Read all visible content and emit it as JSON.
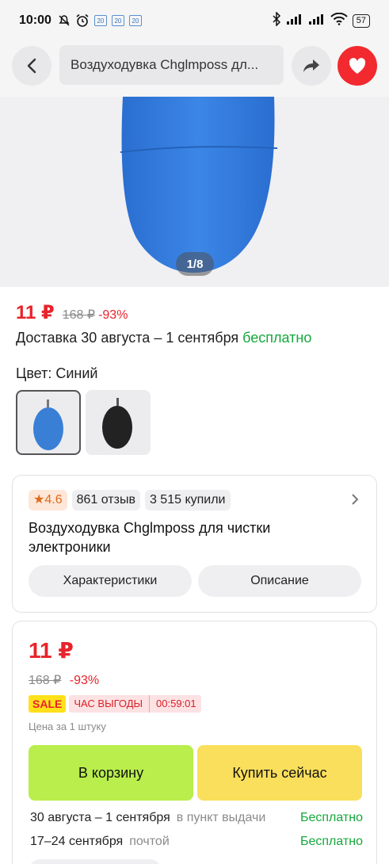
{
  "status_bar": {
    "time": "10:00",
    "calendar_badges": [
      "20",
      "20",
      "20"
    ],
    "battery": "57"
  },
  "header": {
    "search_text": "Воздуходувка Chglmposs дл..."
  },
  "gallery": {
    "pager": "1/8"
  },
  "product": {
    "price": "11 ₽",
    "old_price": "168 ₽",
    "discount": "-93%",
    "delivery_text": "Доставка 30 августа – 1 сентября",
    "delivery_free": "бесплатно",
    "color_label": "Цвет: Синий",
    "swatches": [
      {
        "name": "Синий",
        "selected": true,
        "color": "#3a7fd6"
      },
      {
        "name": "Чёрный",
        "selected": false,
        "color": "#222222"
      }
    ]
  },
  "info_card": {
    "rating": "4.6",
    "reviews": "861 отзыв",
    "bought": "3 515 купили",
    "title": "Воздуходувка Chglmposs для чистки электроники",
    "tab_characteristics": "Характеристики",
    "tab_description": "Описание"
  },
  "buy_box": {
    "price": "11 ₽",
    "old_price": "168 ₽",
    "discount": "-93%",
    "sale_badge": "SALE",
    "hour_badge": "ЧАС ВЫГОДЫ",
    "timer": "00:59:01",
    "per_unit": "Цена за 1 штуку",
    "cart_button": "В корзину",
    "buy_now_button": "Купить сейчас",
    "delivery_options": [
      {
        "dates": "30 августа – 1 сентября",
        "method": "в пункт выдачи",
        "price": "Бесплатно"
      },
      {
        "dates": "17–24 сентября",
        "method": "почтой",
        "price": "Бесплатно"
      }
    ]
  },
  "colors": {
    "accent_red": "#e8232b",
    "free_green": "#14a83b",
    "cart_green": "#b9ee4c",
    "buy_yellow": "#fadf5c"
  }
}
